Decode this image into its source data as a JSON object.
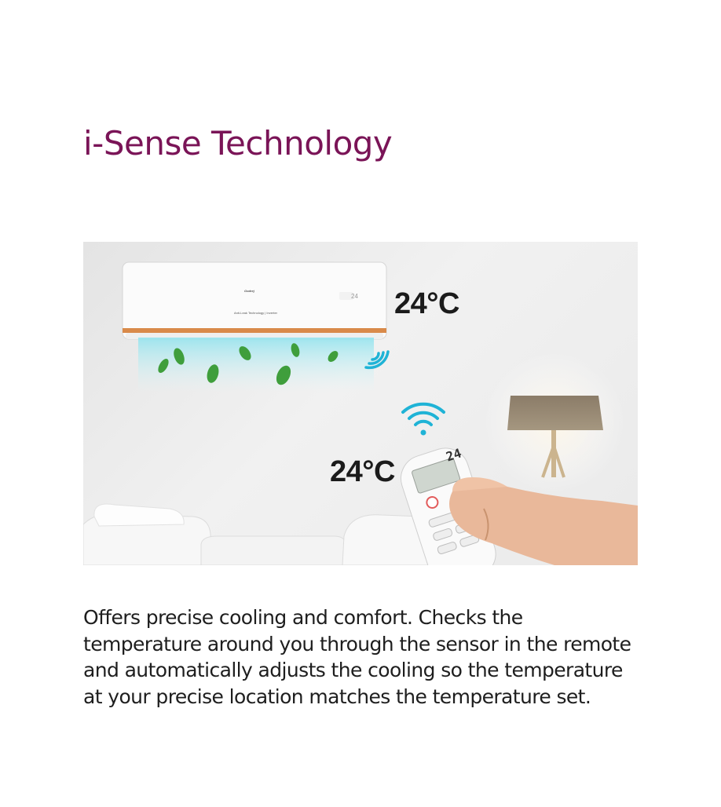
{
  "title": "i-Sense Technology",
  "scene": {
    "ac_unit": {
      "brand_text": "Godrej",
      "label_text": "Anti-Leak Technology | Inverter",
      "display": "24"
    },
    "ac_temperature": "24°C",
    "remote_temperature": "24°C",
    "remote_display": "24"
  },
  "description": "Offers precise cooling and comfort. Checks the temperature around you through the sensor in the remote and automatically adjusts the cooling so the temperature at your precise location matches the temperature set.",
  "colors": {
    "title": "#7a1457",
    "ac_accent": "#d98a4a",
    "wifi_signal": "#1fb3d6",
    "airflow": "#9fe8f0",
    "leaf": "#3a9a3a"
  }
}
